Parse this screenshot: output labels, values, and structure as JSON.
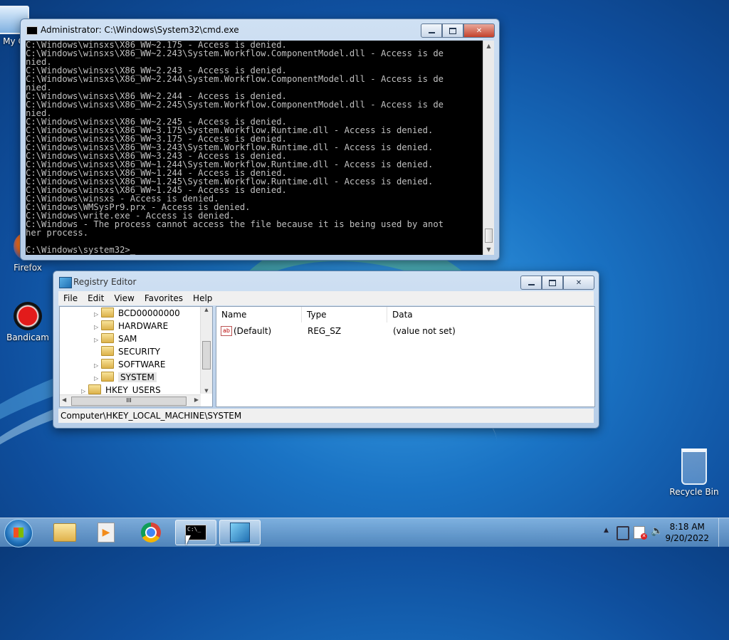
{
  "desktop": {
    "icons": [
      {
        "label": "My C"
      },
      {
        "label": "Firefox"
      },
      {
        "label": "Bandicam"
      },
      {
        "label": "Recycle Bin"
      }
    ]
  },
  "cmd": {
    "title": "Administrator: C:\\Windows\\System32\\cmd.exe",
    "lines": [
      "C:\\Windows\\winsxs\\X86_WW~2.175 - Access is denied.",
      "C:\\Windows\\winsxs\\X86_WW~2.243\\System.Workflow.ComponentModel.dll - Access is de",
      "nied.",
      "C:\\Windows\\winsxs\\X86_WW~2.243 - Access is denied.",
      "C:\\Windows\\winsxs\\X86_WW~2.244\\System.Workflow.ComponentModel.dll - Access is de",
      "nied.",
      "C:\\Windows\\winsxs\\X86_WW~2.244 - Access is denied.",
      "C:\\Windows\\winsxs\\X86_WW~2.245\\System.Workflow.ComponentModel.dll - Access is de",
      "nied.",
      "C:\\Windows\\winsxs\\X86_WW~2.245 - Access is denied.",
      "C:\\Windows\\winsxs\\X86_WW~3.175\\System.Workflow.Runtime.dll - Access is denied.",
      "C:\\Windows\\winsxs\\X86_WW~3.175 - Access is denied.",
      "C:\\Windows\\winsxs\\X86_WW~3.243\\System.Workflow.Runtime.dll - Access is denied.",
      "C:\\Windows\\winsxs\\X86_WW~3.243 - Access is denied.",
      "C:\\Windows\\winsxs\\X86_WW~1.244\\System.Workflow.Runtime.dll - Access is denied.",
      "C:\\Windows\\winsxs\\X86_WW~1.244 - Access is denied.",
      "C:\\Windows\\winsxs\\X86_WW~1.245\\System.Workflow.Runtime.dll - Access is denied.",
      "C:\\Windows\\winsxs\\X86_WW~1.245 - Access is denied.",
      "C:\\Windows\\winsxs - Access is denied.",
      "C:\\Windows\\WMSysPr9.prx - Access is denied.",
      "C:\\Windows\\write.exe - Access is denied.",
      "C:\\Windows - The process cannot access the file because it is being used by anot",
      "her process.",
      "",
      "C:\\Windows\\system32>_"
    ]
  },
  "regedit": {
    "title": "Registry Editor",
    "menu": [
      "File",
      "Edit",
      "View",
      "Favorites",
      "Help"
    ],
    "tree": [
      "BCD00000000",
      "HARDWARE",
      "SAM",
      "SECURITY",
      "SOFTWARE",
      "SYSTEM",
      "HKEY_USERS"
    ],
    "columns": [
      "Name",
      "Type",
      "Data"
    ],
    "values": [
      {
        "name": "(Default)",
        "type": "REG_SZ",
        "data": "(value not set)"
      }
    ],
    "scroll_glyph": "III",
    "icon_text": "ab",
    "status": "Computer\\HKEY_LOCAL_MACHINE\\SYSTEM"
  },
  "taskbar": {
    "cmd_glyph": "C:\\_",
    "time": "8:18 AM",
    "date": "9/20/2022"
  }
}
